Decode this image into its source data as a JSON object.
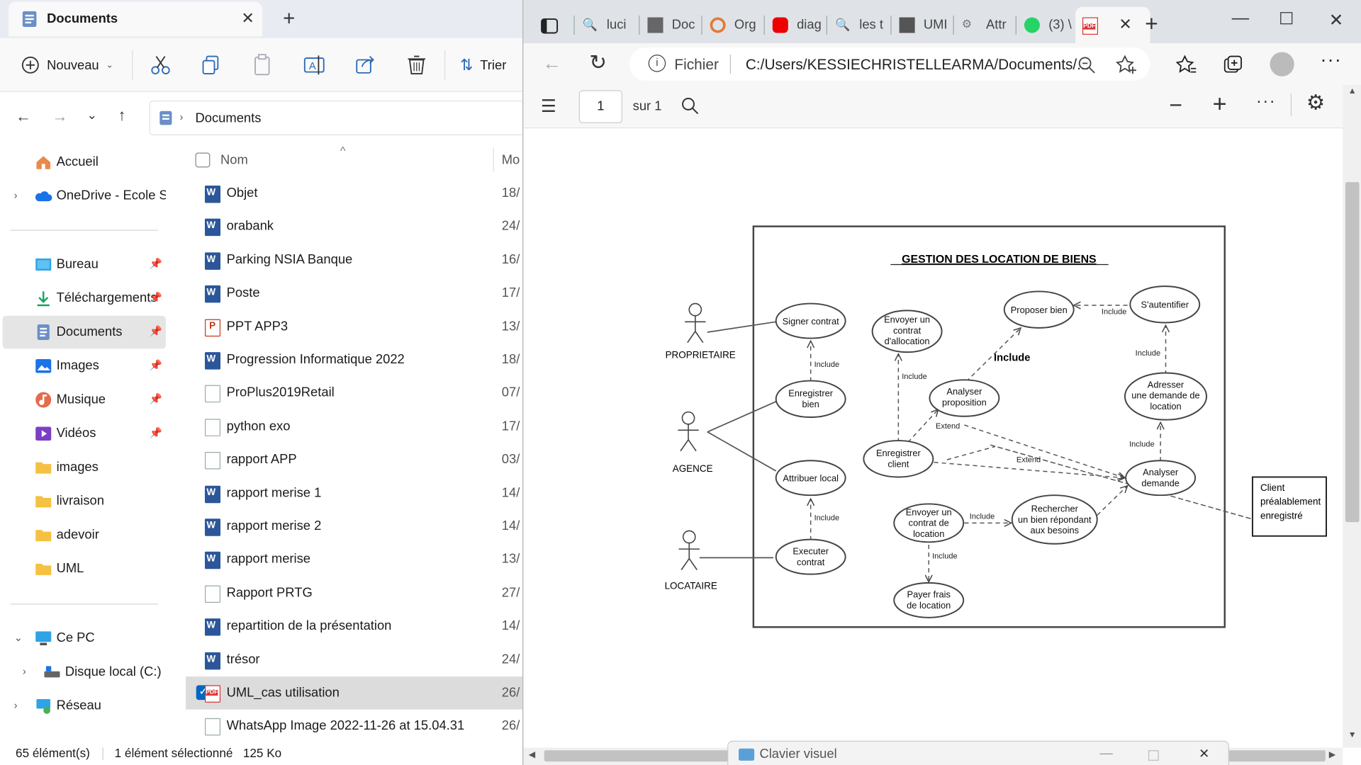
{
  "explorer": {
    "tab_title": "Documents",
    "toolbar": {
      "new_label": "Nouveau",
      "sort_label": "Trier"
    },
    "breadcrumb": {
      "current": "Documents"
    },
    "nav": {
      "quick": [
        "Accueil",
        "OneDrive - Ecole Su"
      ],
      "pinned": [
        "Bureau",
        "Téléchargements",
        "Documents",
        "Images",
        "Musique",
        "Vidéos"
      ],
      "folders": [
        "images",
        "livraison",
        "adevoir",
        "UML"
      ],
      "system": [
        "Ce PC",
        "Disque local (C:)",
        "Réseau"
      ]
    },
    "columns": {
      "name": "Nom",
      "modified": "Mo"
    },
    "files": [
      {
        "name": "Objet",
        "date": "18/",
        "type": "word"
      },
      {
        "name": "orabank",
        "date": "24/",
        "type": "word"
      },
      {
        "name": "Parking NSIA Banque",
        "date": "16/",
        "type": "word"
      },
      {
        "name": "Poste",
        "date": "17/",
        "type": "word"
      },
      {
        "name": "PPT APP3",
        "date": "13/",
        "type": "ppt"
      },
      {
        "name": "Progression Informatique 2022",
        "date": "18/",
        "type": "word"
      },
      {
        "name": "ProPlus2019Retail",
        "date": "07/",
        "type": "generic"
      },
      {
        "name": "python exo",
        "date": "17/",
        "type": "text"
      },
      {
        "name": "rapport APP",
        "date": "03/",
        "type": "text"
      },
      {
        "name": "rapport merise 1",
        "date": "14/",
        "type": "word"
      },
      {
        "name": "rapport merise 2",
        "date": "14/",
        "type": "word"
      },
      {
        "name": "rapport merise",
        "date": "13/",
        "type": "word"
      },
      {
        "name": "Rapport PRTG",
        "date": "27/",
        "type": "text"
      },
      {
        "name": "repartition de la présentation",
        "date": "14/",
        "type": "word"
      },
      {
        "name": "trésor",
        "date": "24/",
        "type": "word"
      },
      {
        "name": "UML_cas utilisation",
        "date": "26/",
        "type": "pdf",
        "selected": true
      },
      {
        "name": "WhatsApp Image 2022-11-26 at 15.04.31",
        "date": "26/",
        "type": "image"
      }
    ],
    "status": {
      "count": "65 élément(s)",
      "selection": "1 élément sélectionné",
      "size": "125 Ko"
    }
  },
  "edge": {
    "tabs": [
      "luci",
      "Doc",
      "Org",
      "diag",
      "les t",
      "UMI",
      "Attr",
      "(3) \\"
    ],
    "address": {
      "scheme": "Fichier",
      "url": "C:/Users/KESSIECHRISTELLEARMA/Documents/..."
    },
    "pdf": {
      "page": "1",
      "of_label": "sur 1"
    },
    "keyboard": "Clavier visuel"
  },
  "diagram": {
    "title": "GESTION DES LOCATION DE BIENS",
    "actors": {
      "owner": "PROPRIETAIRE",
      "agency": "AGENCE",
      "tenant": "LOCATAIRE"
    },
    "external_box": [
      "Client",
      "préalablement",
      "enregistré"
    ],
    "usecases": {
      "signer": [
        "Signer contrat"
      ],
      "enreg_bien": [
        "Enregistrer",
        "bien"
      ],
      "attribuer": [
        "Attribuer local"
      ],
      "executer": [
        "Executer",
        "contrat"
      ],
      "envoyer_alloc": [
        "Envoyer un",
        "contrat",
        "d'allocation"
      ],
      "proposer": [
        "Proposer bien"
      ],
      "authentifier": [
        "S'autentifier"
      ],
      "analyser_prop": [
        "Analyser",
        "proposition"
      ],
      "adresser": [
        "Adresser",
        "une demande de",
        "location"
      ],
      "enreg_client": [
        "Enregistrer",
        "client"
      ],
      "analyser_dem": [
        "Analyser",
        "demande"
      ],
      "envoyer_loc": [
        "Envoyer un",
        "contrat de",
        "location"
      ],
      "rechercher": [
        "Rechercher",
        "un bien répondant",
        "aux besoins"
      ],
      "payer": [
        "Payer frais",
        "de location"
      ]
    },
    "labels": {
      "include": "Include",
      "include_bold": "Include",
      "extend": "Extend"
    }
  }
}
